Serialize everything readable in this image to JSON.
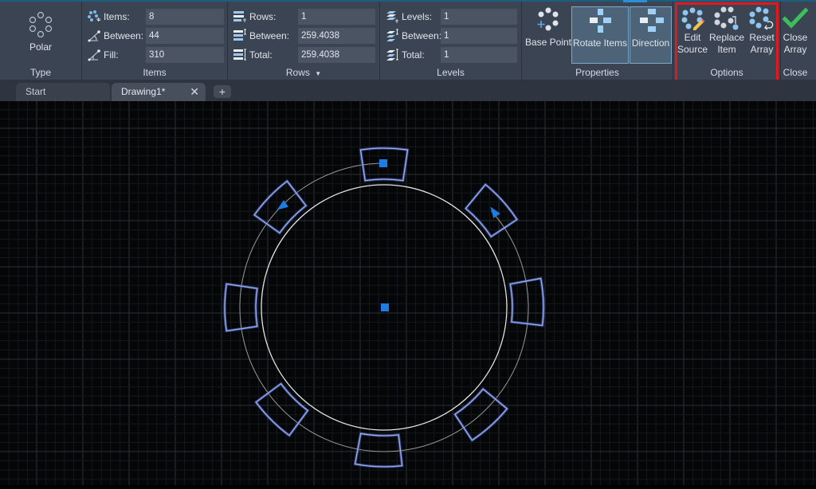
{
  "ribbon": {
    "type_panel": {
      "title": "Type",
      "button": "Polar",
      "icon": "polar-array-icon"
    },
    "items_panel": {
      "title": "Items",
      "rows": [
        {
          "label": "Items:",
          "value": "8",
          "icon": "items-count-icon"
        },
        {
          "label": "Between:",
          "value": "44",
          "icon": "angle-between-icon"
        },
        {
          "label": "Fill:",
          "value": "310",
          "icon": "fill-angle-icon"
        }
      ]
    },
    "rows_panel": {
      "title": "Rows",
      "dropdown_icon": "chevron-down-icon",
      "rows": [
        {
          "label": "Rows:",
          "value": "1",
          "icon": "rows-count-icon"
        },
        {
          "label": "Between:",
          "value": "259.4038",
          "icon": "row-spacing-icon"
        },
        {
          "label": "Total:",
          "value": "259.4038",
          "icon": "row-total-icon"
        }
      ]
    },
    "levels_panel": {
      "title": "Levels",
      "rows": [
        {
          "label": "Levels:",
          "value": "1",
          "icon": "levels-count-icon"
        },
        {
          "label": "Between:",
          "value": "1",
          "icon": "level-spacing-icon"
        },
        {
          "label": "Total:",
          "value": "1",
          "icon": "level-total-icon"
        }
      ]
    },
    "properties_panel": {
      "title": "Properties",
      "buttons": [
        {
          "label": "Base Point",
          "icon": "base-point-icon",
          "active": false
        },
        {
          "label": "Rotate Items",
          "icon": "rotate-items-icon",
          "active": true
        },
        {
          "label": "Direction",
          "icon": "direction-icon",
          "active": true
        }
      ]
    },
    "options_panel": {
      "title": "Options",
      "buttons": [
        {
          "label_line1": "Edit",
          "label_line2": "Source",
          "icon": "edit-source-icon"
        },
        {
          "label_line1": "Replace",
          "label_line2": "Item",
          "icon": "replace-item-icon"
        },
        {
          "label_line1": "Reset",
          "label_line2": "Array",
          "icon": "reset-array-icon"
        }
      ]
    },
    "close_panel": {
      "title": "Close",
      "button_line1": "Close",
      "button_line2": "Array",
      "icon": "checkmark-icon"
    }
  },
  "tabs": [
    {
      "label": "Start",
      "active": false
    },
    {
      "label": "Drawing1*",
      "active": true
    }
  ],
  "colors": {
    "ribbon_bg": "#3b4453",
    "field_bg": "#4b5463",
    "canvas_bg": "#050607",
    "grip_blue": "#1e7ce6",
    "array_item_outline": "#9fb2e6",
    "highlight_red": "#e0191e",
    "check_green": "#3cc15a"
  },
  "canvas": {
    "array_items": 8,
    "item_angles_deg": [
      90,
      136,
      180,
      -135,
      -92,
      -48,
      2,
      42
    ]
  }
}
